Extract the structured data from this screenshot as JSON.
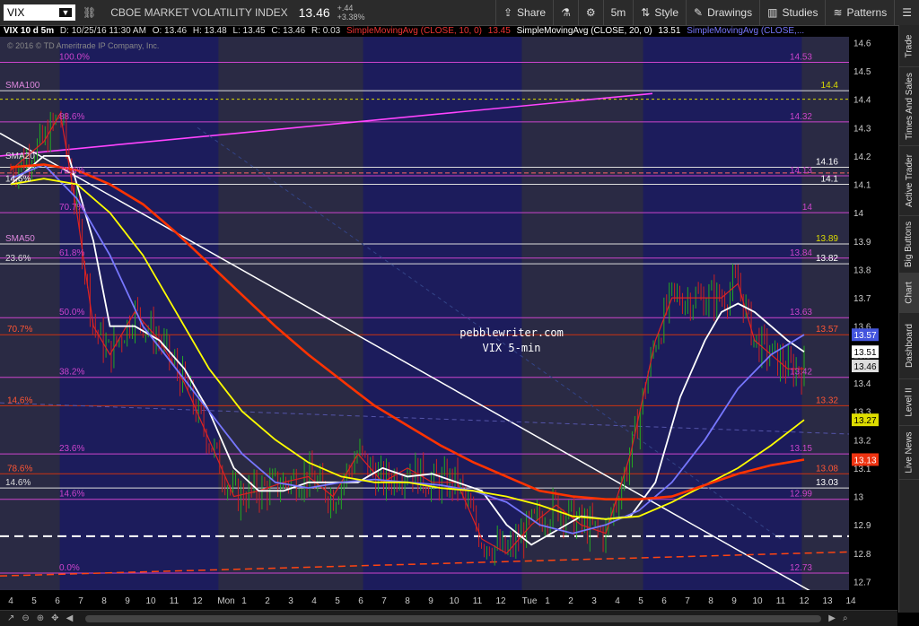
{
  "toolbar": {
    "symbol": "VIX",
    "symbol_dropdown_icon": "caret-down-icon",
    "name": "CBOE MARKET VOLATILITY INDEX",
    "last": "13.46",
    "change": "+.44",
    "change_pct": "+3.38%",
    "share": "Share",
    "timeframe": "5m",
    "style": "Style",
    "drawings": "Drawings",
    "studies": "Studies",
    "patterns": "Patterns"
  },
  "info": {
    "symbol_period": "VIX 10 d 5m",
    "datetime": "D: 10/25/16 11:30 AM",
    "open": "O: 13.46",
    "high": "H: 13.48",
    "low": "L: 13.45",
    "close": "C: 13.46",
    "range": "R: 0.03",
    "sma10_label": "SimpleMovingAvg (CLOSE, 10, 0)",
    "sma10_val": "13.45",
    "sma20_label": "SimpleMovingAvg (CLOSE, 20, 0)",
    "sma20_val": "13.51",
    "sma_more": "SimpleMovingAvg (CLOSE,..."
  },
  "copyright": "© 2016 © TD Ameritrade IP Company, Inc.",
  "watermark_1": "pebblewriter.com",
  "watermark_2": "VIX 5-min",
  "sidebar_tabs": [
    "Trade",
    "Times And Sales",
    "Active Trader",
    "Big Buttons",
    "Chart",
    "Dashboard",
    "Level II",
    "Live News"
  ],
  "colors": {
    "background": "#000000",
    "night_session": "#1c1c5c",
    "price_up": "#22aa22",
    "price_down": "#cc2222",
    "sma10": "#dd2222",
    "sma20": "#ffffff",
    "sma50": "#7777ff",
    "sma100": "#ffff00",
    "sma200": "#ff3300",
    "fib": "#cc44cc",
    "trend": "#ff44ff"
  },
  "chart_data": {
    "type": "line",
    "ylim": [
      12.67,
      14.62
    ],
    "y_ticks": [
      12.7,
      12.8,
      12.9,
      13,
      13.1,
      13.2,
      13.3,
      13.4,
      13.5,
      13.6,
      13.7,
      13.8,
      13.9,
      14,
      14.1,
      14.2,
      14.3,
      14.4,
      14.5,
      14.6
    ],
    "x_ticks": [
      "4",
      "5",
      "6",
      "7",
      "8",
      "9",
      "10",
      "11",
      "12",
      "Mon",
      "1",
      "2",
      "3",
      "4",
      "5",
      "6",
      "7",
      "8",
      "9",
      "10",
      "11",
      "12",
      "Tue",
      "1",
      "2",
      "3",
      "4",
      "5",
      "6",
      "7",
      "8",
      "9",
      "10",
      "11",
      "12",
      "13",
      "14"
    ],
    "fib_levels": [
      {
        "label": "100.0%",
        "price": "14.53",
        "value": 14.53
      },
      {
        "label": "88.6%",
        "price": "14.32",
        "value": 14.32
      },
      {
        "label": "78.6%",
        "price": "14.13",
        "value": 14.13
      },
      {
        "label": "70.7%",
        "price": "14",
        "value": 14.0
      },
      {
        "label": "61.8%",
        "price": "13.84",
        "value": 13.84
      },
      {
        "label": "50.0%",
        "price": "13.63",
        "value": 13.63
      },
      {
        "label": "38.2%",
        "price": "13.42",
        "value": 13.42
      },
      {
        "label": "23.6%",
        "price": "13.15",
        "value": 13.15
      },
      {
        "label": "14.6%",
        "price": "12.99",
        "value": 12.99
      },
      {
        "label": "0.0%",
        "price": "12.73",
        "value": 12.73
      }
    ],
    "red_levels": [
      {
        "label": "70.7%",
        "price": "13.57",
        "value": 13.57
      },
      {
        "label": "14.6%",
        "price": "13.32",
        "value": 13.32
      },
      {
        "label": "78.6%",
        "price": "13.08",
        "value": 13.08
      }
    ],
    "white_levels": [
      {
        "label": "SMA100",
        "price": "14.4",
        "value": 14.43
      },
      {
        "label": "14.6%",
        "price": "14.1",
        "value": 14.1
      },
      {
        "label": "",
        "price": "14.16",
        "value": 14.16
      },
      {
        "label": "SMA50",
        "price": "13.89",
        "value": 13.89
      },
      {
        "label": "23.6%",
        "price": "13.82",
        "value": 13.82
      },
      {
        "label": "14.6%",
        "price": "13.03",
        "value": 13.03
      }
    ],
    "extra_labels": [
      {
        "label": "SMA20",
        "value": 14.18
      },
      {
        "label": "14.6%",
        "value": 14.1
      }
    ],
    "right_badges": [
      {
        "price": "13.57",
        "value": 13.57,
        "color": "#4455dd"
      },
      {
        "price": "13.51",
        "value": 13.51,
        "color": "#ffffff"
      },
      {
        "price": "13.46",
        "value": 13.46,
        "color": "#dddddd"
      },
      {
        "price": "13.27",
        "value": 13.27,
        "color": "#dddd00"
      },
      {
        "price": "13.13",
        "value": 13.13,
        "color": "#ee3311"
      }
    ],
    "series": [
      {
        "name": "SMA10",
        "color": "#dd2222",
        "x": [
          0,
          4,
          6,
          8,
          10,
          12,
          15,
          18,
          21,
          24,
          27,
          30,
          33,
          36,
          39,
          42,
          45,
          48,
          51,
          54,
          57,
          60,
          63,
          66,
          69,
          72,
          75,
          78,
          80,
          83,
          86,
          88,
          90,
          92,
          94,
          96
        ],
        "values": [
          14.15,
          14.25,
          14.35,
          14.0,
          13.6,
          13.5,
          13.65,
          13.55,
          13.4,
          13.2,
          13.0,
          13.02,
          13.05,
          13.07,
          13.0,
          13.15,
          13.05,
          13.1,
          13.05,
          13.05,
          12.85,
          12.8,
          12.9,
          12.97,
          12.9,
          12.87,
          13.15,
          13.55,
          13.7,
          13.7,
          13.7,
          13.75,
          13.55,
          13.5,
          13.45,
          13.45
        ]
      },
      {
        "name": "SMA20",
        "color": "#ffffff",
        "x": [
          0,
          4,
          7,
          10,
          12,
          15,
          18,
          21,
          24,
          27,
          30,
          33,
          36,
          39,
          42,
          45,
          48,
          51,
          54,
          57,
          60,
          63,
          66,
          69,
          72,
          75,
          78,
          81,
          84,
          86,
          88,
          90,
          92,
          94,
          96
        ],
        "values": [
          14.1,
          14.2,
          14.2,
          13.9,
          13.6,
          13.6,
          13.55,
          13.45,
          13.3,
          13.1,
          13.02,
          13.02,
          13.05,
          13.05,
          13.05,
          13.1,
          13.07,
          13.08,
          13.05,
          13.02,
          12.9,
          12.83,
          12.88,
          12.93,
          12.92,
          12.93,
          13.05,
          13.35,
          13.55,
          13.65,
          13.68,
          13.65,
          13.6,
          13.55,
          13.51
        ]
      },
      {
        "name": "SMA50",
        "color": "#7777ff",
        "x": [
          0,
          4,
          8,
          12,
          16,
          20,
          24,
          28,
          32,
          36,
          40,
          44,
          48,
          52,
          56,
          60,
          64,
          68,
          72,
          76,
          80,
          84,
          88,
          92,
          96
        ],
        "values": [
          14.12,
          14.17,
          14.05,
          13.85,
          13.6,
          13.45,
          13.3,
          13.15,
          13.05,
          13.03,
          13.05,
          13.06,
          13.05,
          13.04,
          13.02,
          12.98,
          12.9,
          12.87,
          12.9,
          12.95,
          13.05,
          13.2,
          13.38,
          13.5,
          13.57
        ]
      },
      {
        "name": "SMA100",
        "color": "#ffff00",
        "x": [
          0,
          4,
          8,
          12,
          16,
          20,
          24,
          28,
          32,
          36,
          40,
          44,
          48,
          52,
          56,
          60,
          64,
          68,
          72,
          76,
          80,
          84,
          88,
          92,
          96
        ],
        "values": [
          14.1,
          14.12,
          14.1,
          14.0,
          13.85,
          13.65,
          13.45,
          13.3,
          13.2,
          13.12,
          13.07,
          13.05,
          13.05,
          13.03,
          13.02,
          13.0,
          12.97,
          12.93,
          12.92,
          12.93,
          12.98,
          13.04,
          13.1,
          13.18,
          13.27
        ]
      },
      {
        "name": "SMA200",
        "color": "#ff3300",
        "x": [
          0,
          4,
          8,
          12,
          16,
          20,
          24,
          28,
          32,
          36,
          40,
          44,
          48,
          52,
          56,
          60,
          64,
          68,
          72,
          76,
          80,
          84,
          88,
          92,
          96
        ],
        "values": [
          14.16,
          14.17,
          14.15,
          14.1,
          14.03,
          13.93,
          13.82,
          13.71,
          13.6,
          13.5,
          13.41,
          13.32,
          13.25,
          13.18,
          13.12,
          13.07,
          13.02,
          13.0,
          12.99,
          12.99,
          13.0,
          13.04,
          13.08,
          13.11,
          13.13
        ]
      }
    ]
  }
}
